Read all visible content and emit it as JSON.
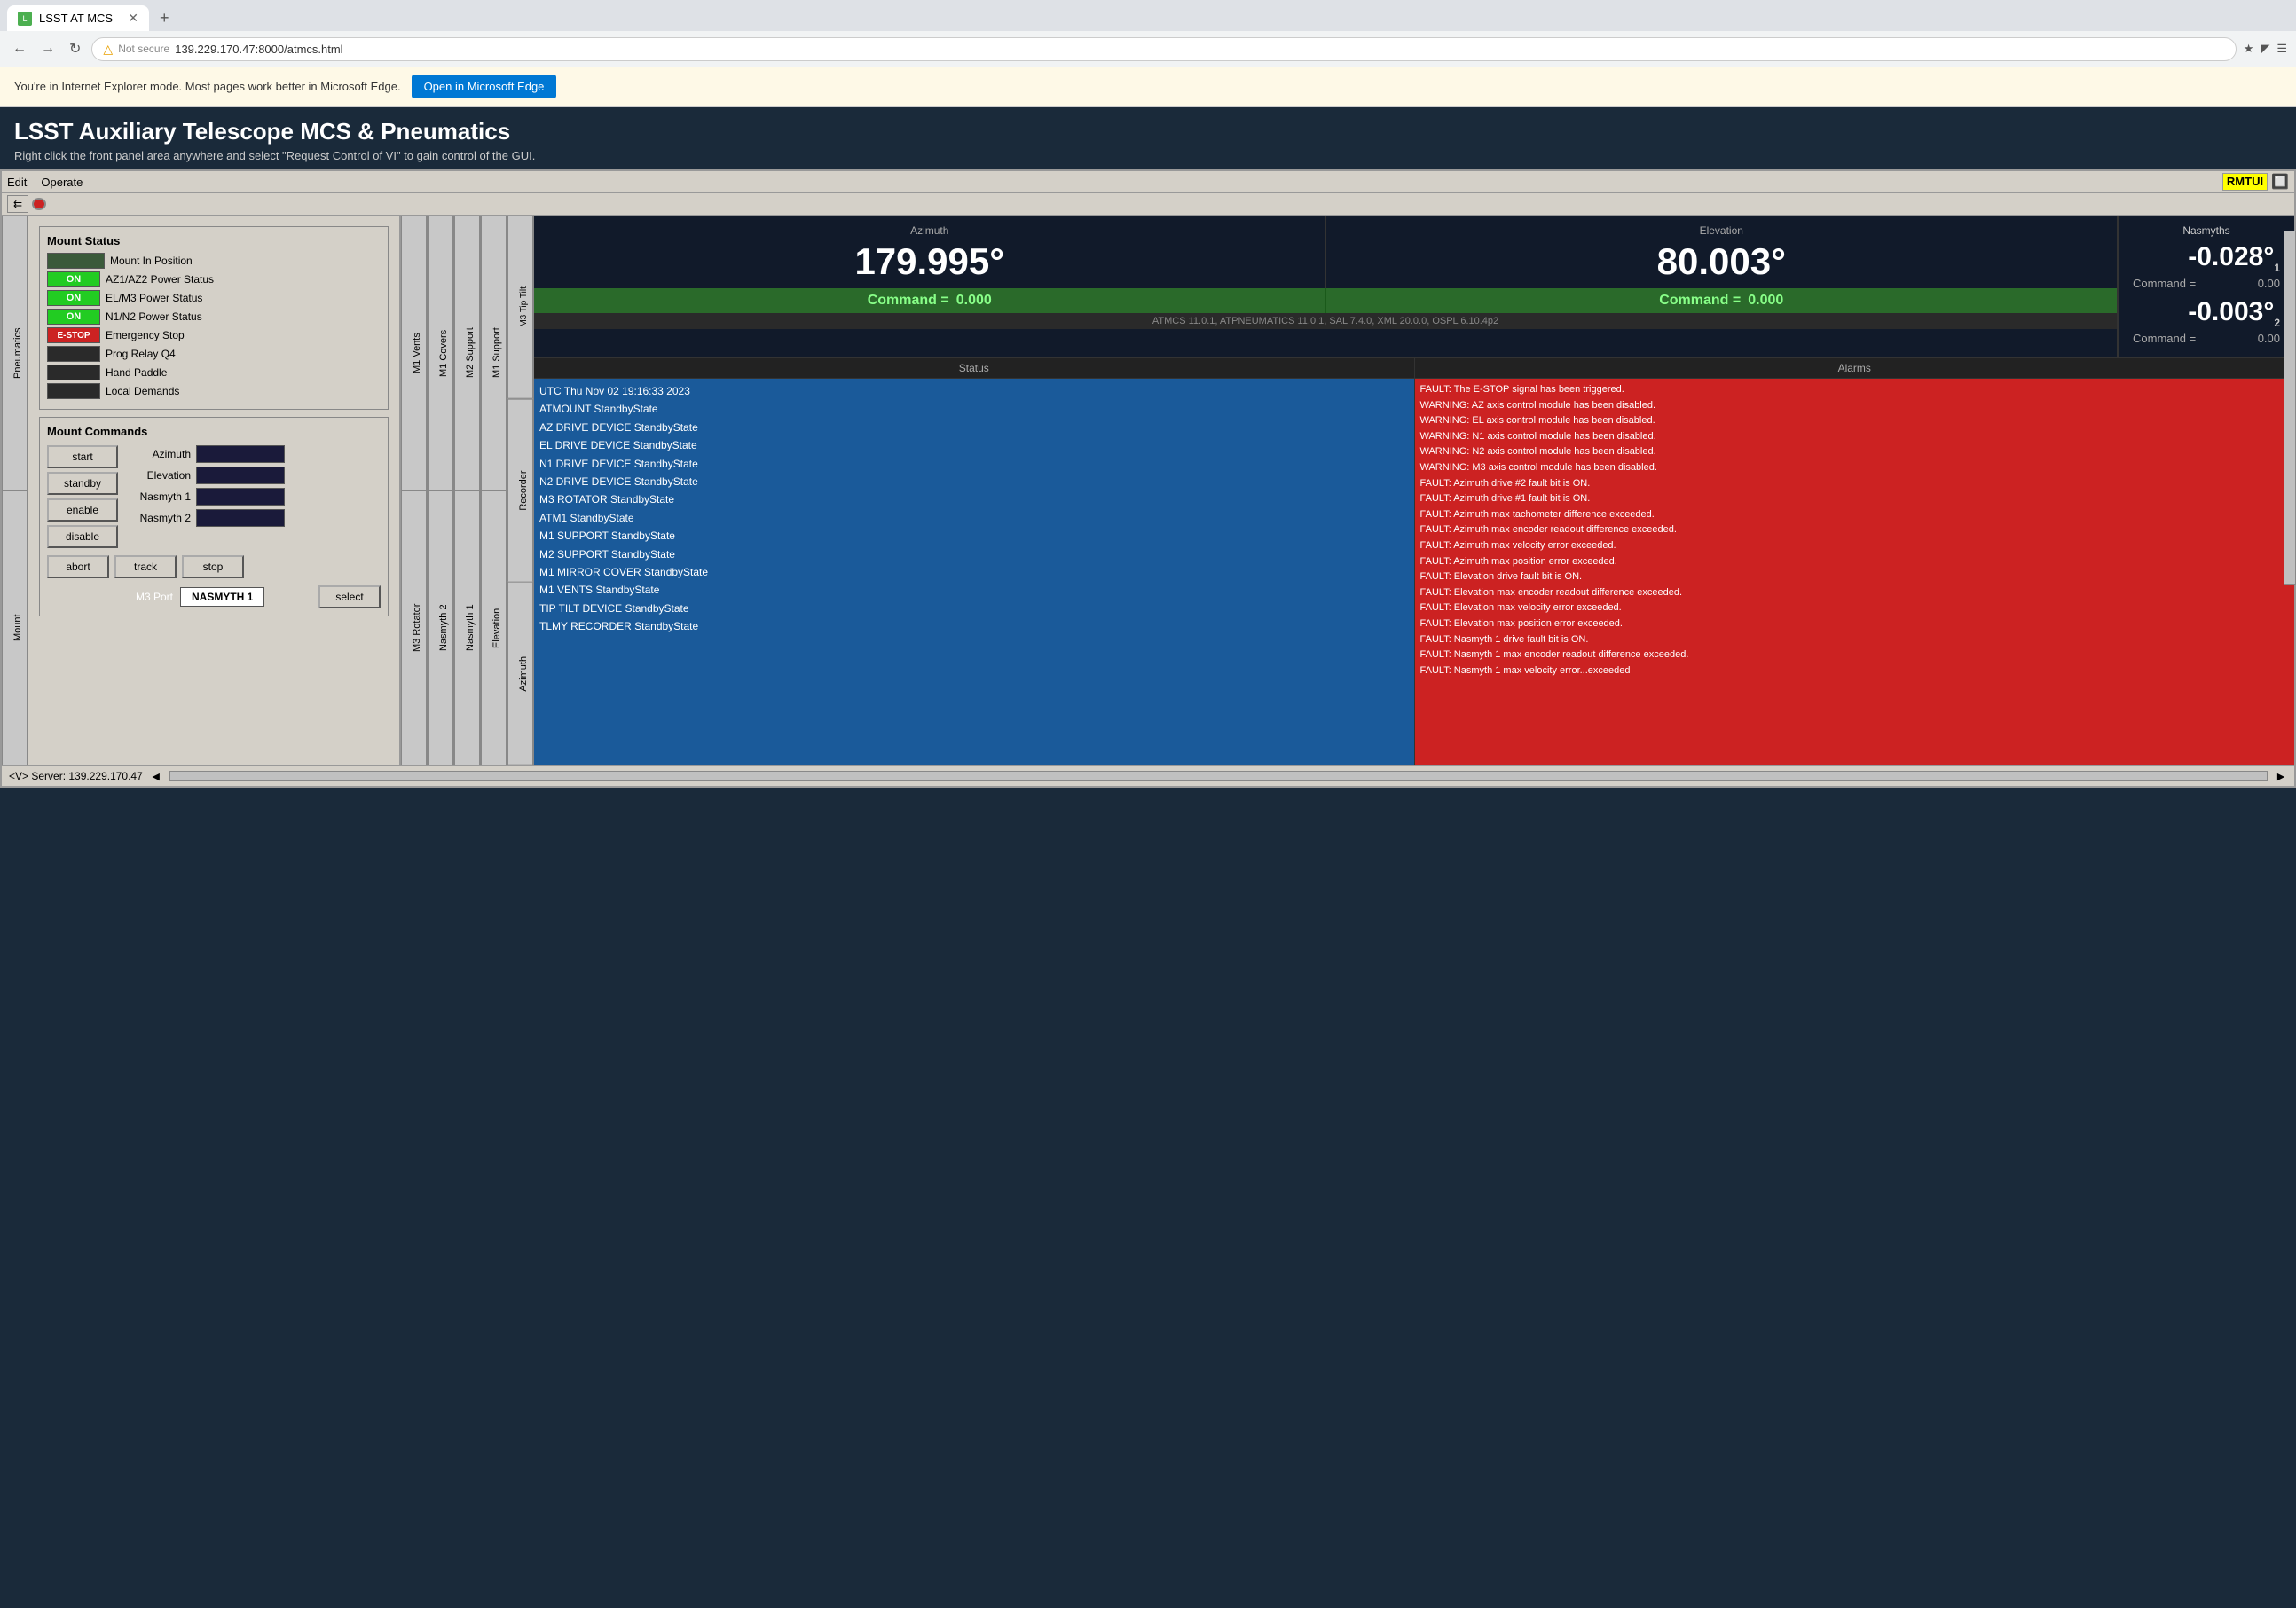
{
  "browser": {
    "tab_title": "LSST AT MCS",
    "url": "139.229.170.47:8000/atmcs.html",
    "url_prefix": "Not secure",
    "ie_banner": "You're in Internet Explorer mode. Most pages work better in Microsoft Edge.",
    "ie_banner_btn": "Open in Microsoft Edge",
    "new_tab_symbol": "+"
  },
  "app": {
    "title": "LSST Auxiliary Telescope MCS & Pneumatics",
    "subtitle": "Right click the front panel area anywhere and select \"Request Control of VI\" to gain control of the GUI."
  },
  "menubar": {
    "edit": "Edit",
    "operate": "Operate",
    "rmtui": "RMTUI"
  },
  "mount_status": {
    "title": "Mount Status",
    "rows": [
      {
        "indicator": "",
        "indicator_class": "status-dark",
        "label": "Mount In Position",
        "text": ""
      },
      {
        "indicator": "ON",
        "indicator_class": "status-green-on",
        "label": "AZ1/AZ2 Power Status",
        "text": "ON"
      },
      {
        "indicator": "ON",
        "indicator_class": "status-green-on",
        "label": "EL/M3 Power Status",
        "text": "ON"
      },
      {
        "indicator": "ON",
        "indicator_class": "status-green-on",
        "label": "N1/N2 Power Status",
        "text": "ON"
      },
      {
        "indicator": "E-STOP",
        "indicator_class": "status-red",
        "label": "Emergency Stop",
        "text": "E-STOP"
      },
      {
        "indicator": "",
        "indicator_class": "status-dark",
        "label": "Prog Relay Q4",
        "text": ""
      },
      {
        "indicator": "",
        "indicator_class": "status-dark",
        "label": "Hand Paddle",
        "text": ""
      },
      {
        "indicator": "",
        "indicator_class": "status-dark",
        "label": "Local Demands",
        "text": ""
      }
    ]
  },
  "mount_commands": {
    "title": "Mount Commands",
    "buttons": {
      "start": "start",
      "standby": "standby",
      "enable": "enable",
      "disable": "disable",
      "abort": "abort",
      "track": "track",
      "stop": "stop",
      "select": "select"
    },
    "fields": {
      "azimuth_label": "Azimuth",
      "elevation_label": "Elevation",
      "nasmyth1_label": "Nasmyth 1",
      "nasmyth2_label": "Nasmyth 2",
      "m3_port_label": "M3 Port",
      "m3_port_value": "NASMYTH 1"
    }
  },
  "axes": {
    "azimuth": {
      "title": "Azimuth",
      "value": "179.995°",
      "command_label": "Command =",
      "command_value": "0.000"
    },
    "elevation": {
      "title": "Elevation",
      "value": "80.003°",
      "command_label": "Command =",
      "command_value": "0.000"
    },
    "nasmyths": {
      "title": "Nasmyths",
      "value1": "-0.028°",
      "sub1": "1",
      "command1_label": "Command =",
      "command1_value": "0.00",
      "value2": "-0.003°",
      "sub2": "2",
      "command2_label": "Command =",
      "command2_value": "0.00"
    }
  },
  "version_bar": "ATMCS 11.0.1, ATPNEUMATICS 11.0.1, SAL 7.4.0, XML 20.0.0, OSPL 6.10.4p2",
  "status_panel": {
    "title": "Status",
    "items": [
      "UTC Thu Nov 02 19:16:33 2023",
      "ATMOUNT StandbyState",
      "AZ DRIVE DEVICE StandbyState",
      "EL DRIVE DEVICE StandbyState",
      "N1 DRIVE DEVICE StandbyState",
      "N2 DRIVE DEVICE StandbyState",
      "M3 ROTATOR StandbyState",
      "ATM1 StandbyState",
      "M1 SUPPORT StandbyState",
      "M2 SUPPORT StandbyState",
      "M1 MIRROR COVER StandbyState",
      "M1 VENTS StandbyState",
      "TIP TILT DEVICE StandbyState",
      "TLMY RECORDER StandbyState"
    ]
  },
  "alarms_panel": {
    "title": "Alarms",
    "items": [
      "FAULT: The E-STOP signal has been triggered.",
      "WARNING: AZ axis control module has been disabled.",
      "WARNING: EL axis control module has been disabled.",
      "WARNING: N1 axis control module has been disabled.",
      "WARNING: N2 axis control module has been disabled.",
      "WARNING: M3 axis control module has been disabled.",
      "FAULT: Azimuth drive #2 fault bit is ON.",
      "FAULT: Azimuth drive #1 fault bit is ON.",
      "FAULT: Azimuth max tachometer difference exceeded.",
      "FAULT: Azimuth max encoder readout difference exceeded.",
      "FAULT: Azimuth max velocity error exceeded.",
      "FAULT: Azimuth max position error exceeded.",
      "FAULT: Elevation drive fault bit is ON.",
      "FAULT: Elevation max encoder readout difference exceeded.",
      "FAULT: Elevation max velocity error  exceeded.",
      "FAULT: Elevation max position error exceeded.",
      "FAULT: Nasmyth 1 drive fault bit is ON.",
      "FAULT: Nasmyth 1 max encoder readout difference exceeded.",
      "FAULT: Nasmyth 1 max velocity error...exceeded"
    ]
  },
  "sidebar_left_tabs": [
    "Pneumatics",
    "Mount"
  ],
  "sidebar_right_tabs1": [
    "M1 Vents",
    "M3 Rotator"
  ],
  "sidebar_right_tabs2": [
    "M1 Covers",
    "Nasmyth 2"
  ],
  "sidebar_right_tabs3": [
    "M2 Support",
    "Nasmyth 1"
  ],
  "sidebar_right_tabs4": [
    "M1 Support",
    "Elevation"
  ],
  "sidebar_right_tabs5": [
    "M3 Tip Tilt",
    "Recorder",
    "Azimuth"
  ],
  "bottom_bar": {
    "server_label": "<V> Server: 139.229.170.47"
  }
}
